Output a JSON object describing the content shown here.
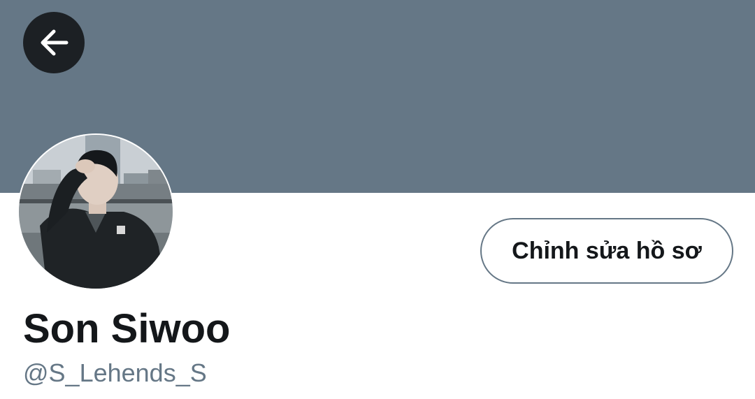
{
  "header": {
    "back_icon": "arrow-left-icon",
    "banner_color": "#657786"
  },
  "profile": {
    "name": "Son Siwoo",
    "handle": "@S_Lehends_S",
    "edit_button_label": "Chỉnh sửa hồ sơ"
  },
  "colors": {
    "text_primary": "#14171a",
    "text_secondary": "#657786",
    "back_button_bg": "#1c2024"
  }
}
